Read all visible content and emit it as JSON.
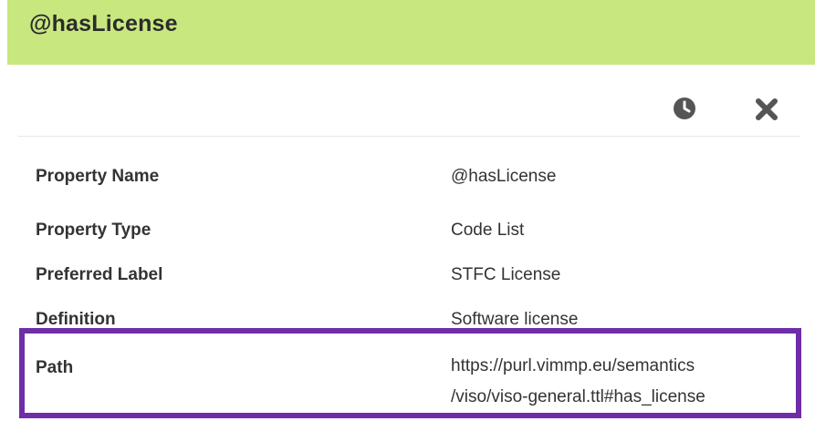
{
  "header": {
    "title": "@hasLicense"
  },
  "toolbar": {
    "history_icon": "history-clock-icon",
    "close_icon": "close-x-icon",
    "icon_color": "#555555"
  },
  "properties": [
    {
      "label": "Property Name",
      "value": "@hasLicense"
    },
    {
      "label": "Property Type",
      "value": "Code List"
    },
    {
      "label": "Preferred Label",
      "value": "STFC License"
    },
    {
      "label": "Definition",
      "value": "Software license"
    },
    {
      "label": "Path",
      "value_line1": "https://purl.vimmp.eu/semantics",
      "value_line2": "/viso/viso-general.ttl#has_license"
    }
  ],
  "colors": {
    "header_background": "#c8e77f",
    "highlight_border": "#6f2da8",
    "text": "#333333"
  }
}
